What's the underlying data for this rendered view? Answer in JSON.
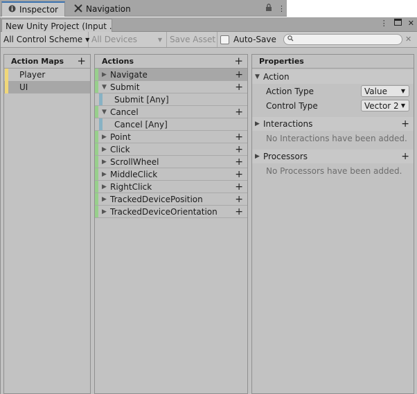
{
  "outer_tabs": [
    {
      "label": "Inspector",
      "icon": "info-icon"
    },
    {
      "label": "Navigation",
      "icon": "navigation-icon"
    }
  ],
  "window": {
    "tab_title": "New Unity Project (Input ..."
  },
  "toolbar": {
    "control_scheme": "All Control Scheme",
    "devices": "All Devices",
    "save_asset": "Save Asset",
    "auto_save": "Auto-Save",
    "auto_save_checked": false,
    "search_value": ""
  },
  "action_maps": {
    "header": "Action Maps",
    "items": [
      {
        "label": "Player",
        "selected": false
      },
      {
        "label": "UI",
        "selected": true
      }
    ]
  },
  "actions": {
    "header": "Actions",
    "items": [
      {
        "label": "Navigate",
        "type": "action",
        "expanded": false,
        "selected": true
      },
      {
        "label": "Submit",
        "type": "action",
        "expanded": true,
        "selected": false
      },
      {
        "label": "Submit [Any]",
        "type": "binding"
      },
      {
        "label": "Cancel",
        "type": "action",
        "expanded": true,
        "selected": false
      },
      {
        "label": "Cancel [Any]",
        "type": "binding"
      },
      {
        "label": "Point",
        "type": "action",
        "expanded": false
      },
      {
        "label": "Click",
        "type": "action",
        "expanded": false
      },
      {
        "label": "ScrollWheel",
        "type": "action",
        "expanded": false
      },
      {
        "label": "MiddleClick",
        "type": "action",
        "expanded": false
      },
      {
        "label": "RightClick",
        "type": "action",
        "expanded": false
      },
      {
        "label": "TrackedDevicePosition",
        "type": "action",
        "expanded": false
      },
      {
        "label": "TrackedDeviceOrientation",
        "type": "action",
        "expanded": false
      }
    ]
  },
  "properties": {
    "header": "Properties",
    "action_section": "Action",
    "action_type_label": "Action Type",
    "action_type_value": "Value",
    "control_type_label": "Control Type",
    "control_type_value": "Vector 2",
    "interactions_section": "Interactions",
    "interactions_empty": "No Interactions have been added.",
    "processors_section": "Processors",
    "processors_empty": "No Processors have been added."
  },
  "colors": {
    "map_bar": "#f0d779",
    "action_bar": "#98cf8c",
    "binding_bar": "#88b2c4",
    "active_tab_accent": "#3a72b0"
  }
}
